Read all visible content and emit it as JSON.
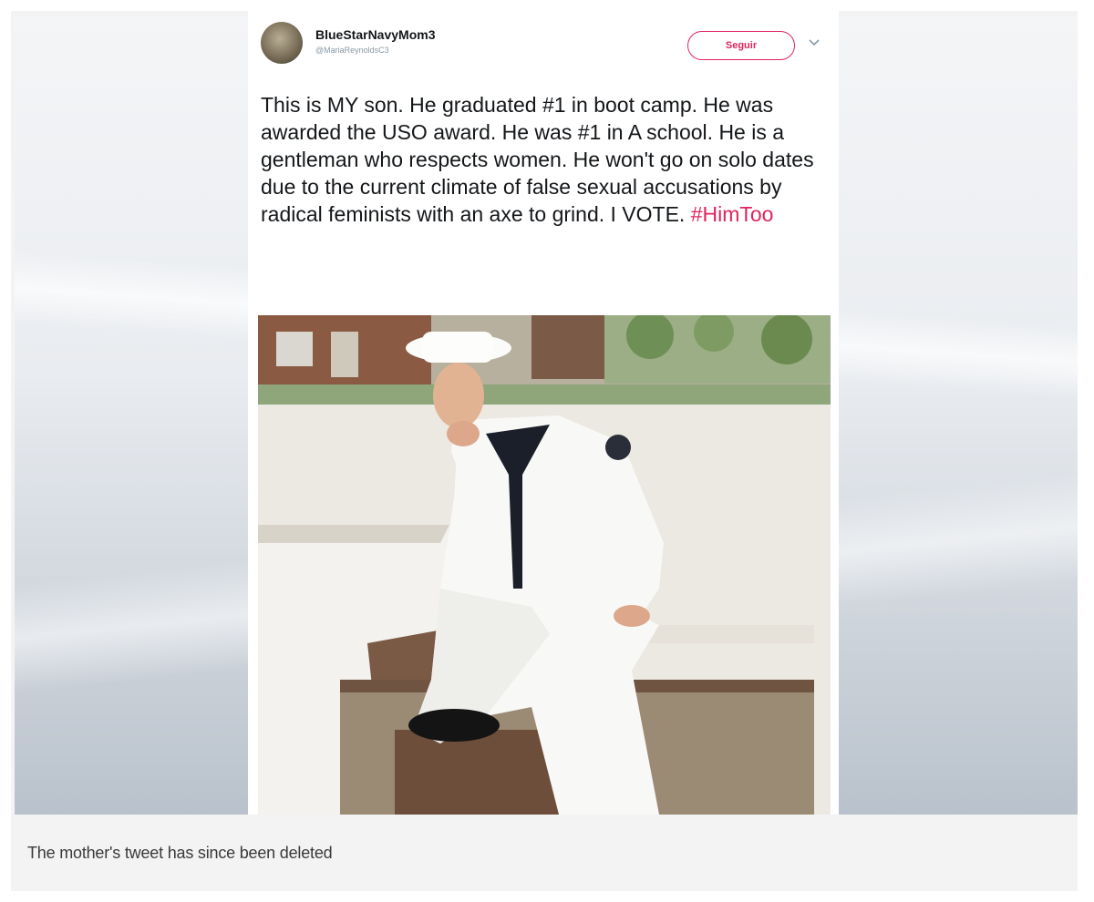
{
  "tweet": {
    "display_name": "BlueStarNavyMom3",
    "handle": "@MariaReynoldsC3",
    "follow_label": "Seguir",
    "text_before_hashtag": "This is MY son. He graduated #1 in boot camp. He was awarded the USO award. He was #1 in A school. He is a gentleman who respects women. He won't go on solo dates due to the current climate of false sexual accusations by radical feminists with an axe to grind. I VOTE. ",
    "hashtag": "#HimToo",
    "accent_color": "#e0245e"
  },
  "caption": "The mother's tweet has since been deleted",
  "icons": [
    "avatar",
    "chevron-down-icon"
  ]
}
